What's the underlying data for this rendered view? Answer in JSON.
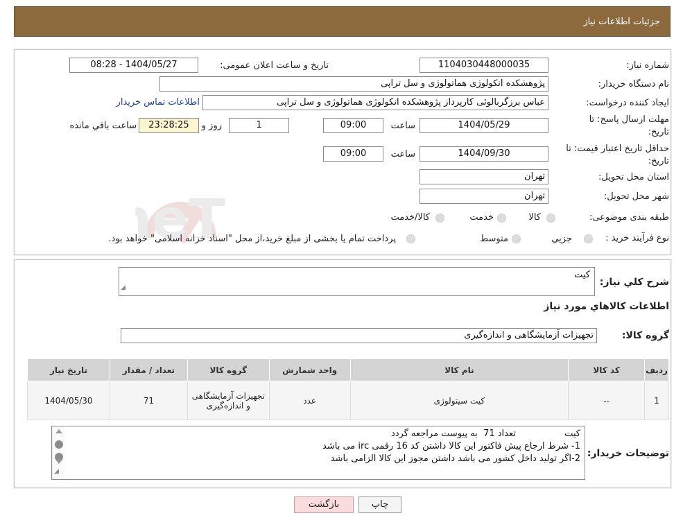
{
  "header": {
    "title": "جزئیات اطلاعات نیاز"
  },
  "form": {
    "need_number": {
      "label": "شماره نیاز:",
      "value": "1104030448000035"
    },
    "announce": {
      "label": "تاریخ و ساعت اعلان عمومی:",
      "value": "1404/05/27 - 08:28"
    },
    "buyer_org": {
      "label": "نام دستگاه خریدار:",
      "value": "پژوهشکده انکولوژی هماتولوژی و سل تراپی"
    },
    "requester": {
      "label": "ایجاد کننده درخواست:",
      "value": "عباس برزگربالوئی کارپرداز پژوهشکده انکولوژی هماتولوژی و سل تراپی",
      "contact_link": "اطلاعات تماس خریدار"
    },
    "reply_deadline": {
      "label": "مهلت ارسال پاسخ: تا تاریخ:",
      "date": "1404/05/29",
      "time_label": "ساعت",
      "time": "09:00",
      "days": "1",
      "days_label": "روز و",
      "remaining": "23:28:25",
      "remaining_label": "ساعت باقي مانده"
    },
    "price_validity": {
      "label": "حداقل تاریخ اعتبار قیمت: تا تاریخ:",
      "date": "1404/09/30",
      "time_label": "ساعت",
      "time": "09:00"
    },
    "province": {
      "label": "استان محل تحویل:",
      "value": "تهران"
    },
    "city": {
      "label": "شهر محل تحویل:",
      "value": "تهران"
    },
    "category": {
      "label": "طبقه بندی موضوعی:",
      "options": [
        "کالا",
        "خدمت",
        "کالا/خدمت"
      ]
    },
    "process": {
      "label": "نوع فرآیند خرید :",
      "options": [
        "جزیي",
        "متوسط"
      ],
      "note": "پرداخت تمام یا بخشی از مبلغ خرید،از محل \"اسناد خزانه اسلامی\" خواهد بود."
    }
  },
  "details": {
    "summary_label": "شرح کلي نياز:",
    "summary_value": "کیت",
    "goods_title": "اطلاعات کالاهاي مورد نياز",
    "group_label": "گروه کالا:",
    "group_value": "تجهیزات آزمایشگاهی و اندازه‌گیری"
  },
  "table": {
    "headers": [
      "ردیف",
      "کد کالا",
      "نام کالا",
      "واحد شمارش",
      "گروه کالا",
      "تعداد / مقدار",
      "تاریخ نیاز"
    ],
    "rows": [
      [
        "1",
        "--",
        "کیت سیتولوژی",
        "عدد",
        "تجهیزات آزمایشگاهی و اندازه‌گیری",
        "71",
        "1404/05/30"
      ]
    ]
  },
  "buyer_notes": {
    "label": "توضیحات خریدار:",
    "lines": [
      "کیت                 تعداد 71  به پیوست مراجعه گردد",
      "1- شرط ارجاع پیش فاکتور این کالا داشتن کد 16 رقمی  irc می باشد",
      "2-اگر تولید داخل  کشور می باشد داشتن مجوز این کالا الزامی باشد"
    ]
  },
  "buttons": {
    "print": "چاپ",
    "back": "بازگشت"
  },
  "watermark": {
    "text": "AriaTender.neT"
  }
}
